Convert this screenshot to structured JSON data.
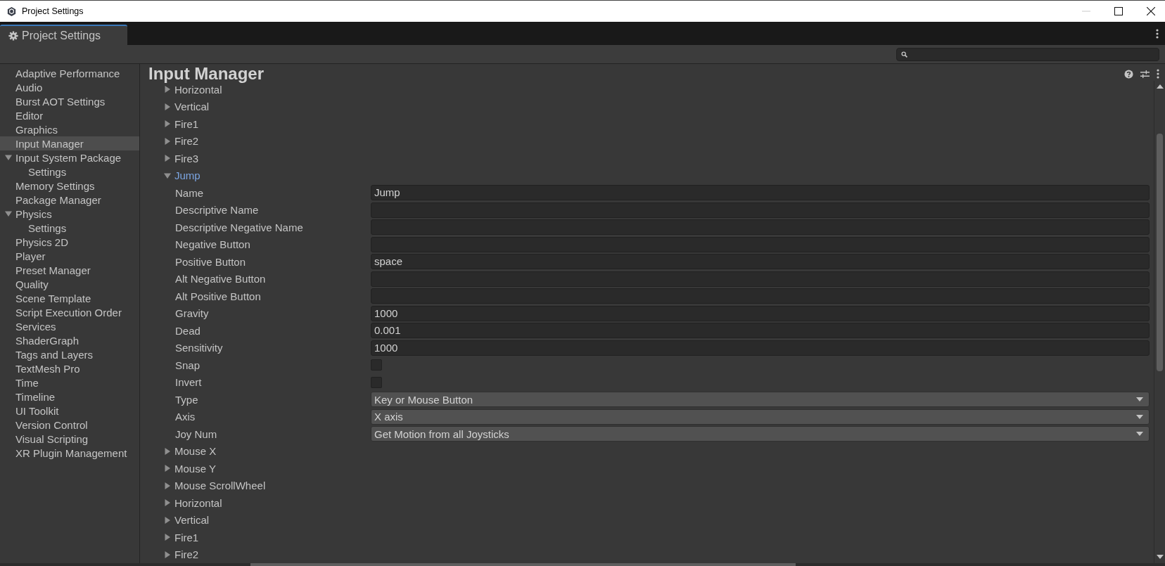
{
  "window": {
    "title": "Project Settings"
  },
  "tab": {
    "label": "Project Settings"
  },
  "sidebar": {
    "items": [
      {
        "label": "Adaptive Performance",
        "selected": false
      },
      {
        "label": "Audio",
        "selected": false
      },
      {
        "label": "Burst AOT Settings",
        "selected": false
      },
      {
        "label": "Editor",
        "selected": false
      },
      {
        "label": "Graphics",
        "selected": false
      },
      {
        "label": "Input Manager",
        "selected": true
      },
      {
        "label": "Input System Package",
        "selected": false,
        "expanded": true,
        "children": [
          {
            "label": "Settings",
            "selected": false
          }
        ]
      },
      {
        "label": "Memory Settings",
        "selected": false
      },
      {
        "label": "Package Manager",
        "selected": false
      },
      {
        "label": "Physics",
        "selected": false,
        "expanded": true,
        "children": [
          {
            "label": "Settings",
            "selected": false
          }
        ]
      },
      {
        "label": "Physics 2D",
        "selected": false
      },
      {
        "label": "Player",
        "selected": false
      },
      {
        "label": "Preset Manager",
        "selected": false
      },
      {
        "label": "Quality",
        "selected": false
      },
      {
        "label": "Scene Template",
        "selected": false
      },
      {
        "label": "Script Execution Order",
        "selected": false
      },
      {
        "label": "Services",
        "selected": false
      },
      {
        "label": "ShaderGraph",
        "selected": false
      },
      {
        "label": "Tags and Layers",
        "selected": false
      },
      {
        "label": "TextMesh Pro",
        "selected": false
      },
      {
        "label": "Time",
        "selected": false
      },
      {
        "label": "Timeline",
        "selected": false
      },
      {
        "label": "UI Toolkit",
        "selected": false
      },
      {
        "label": "Version Control",
        "selected": false
      },
      {
        "label": "Visual Scripting",
        "selected": false
      },
      {
        "label": "XR Plugin Management",
        "selected": false
      }
    ]
  },
  "content": {
    "title": "Input Manager",
    "axes": [
      {
        "name": "Horizontal",
        "expanded": false
      },
      {
        "name": "Vertical",
        "expanded": false
      },
      {
        "name": "Fire1",
        "expanded": false
      },
      {
        "name": "Fire2",
        "expanded": false
      },
      {
        "name": "Fire3",
        "expanded": false
      },
      {
        "name": "Jump",
        "expanded": true,
        "properties": [
          {
            "kind": "text",
            "label": "Name",
            "value": "Jump"
          },
          {
            "kind": "text",
            "label": "Descriptive Name"
          },
          {
            "kind": "text",
            "label": "Descriptive Negative Name"
          },
          {
            "kind": "text",
            "label": "Negative Button"
          },
          {
            "kind": "text",
            "label": "Positive Button",
            "value": "space"
          },
          {
            "kind": "text",
            "label": "Alt Negative Button"
          },
          {
            "kind": "text",
            "label": "Alt Positive Button"
          },
          {
            "kind": "text",
            "label": "Gravity",
            "value": "1000"
          },
          {
            "kind": "text",
            "label": "Dead",
            "value": "0.001"
          },
          {
            "kind": "text",
            "label": "Sensitivity",
            "value": "1000"
          },
          {
            "kind": "checkbox",
            "label": "Snap",
            "checked": false
          },
          {
            "kind": "checkbox",
            "label": "Invert",
            "checked": false
          },
          {
            "kind": "dropdown",
            "label": "Type",
            "value": "Key or Mouse Button"
          },
          {
            "kind": "dropdown",
            "label": "Axis",
            "value": "X axis"
          },
          {
            "kind": "dropdown",
            "label": "Joy Num",
            "value": "Get Motion from all Joysticks"
          }
        ]
      },
      {
        "name": "Mouse X",
        "expanded": false
      },
      {
        "name": "Mouse Y",
        "expanded": false
      },
      {
        "name": "Mouse ScrollWheel",
        "expanded": false
      },
      {
        "name": "Horizontal",
        "expanded": false
      },
      {
        "name": "Vertical",
        "expanded": false
      },
      {
        "name": "Fire1",
        "expanded": false
      },
      {
        "name": "Fire2",
        "expanded": false
      }
    ]
  }
}
